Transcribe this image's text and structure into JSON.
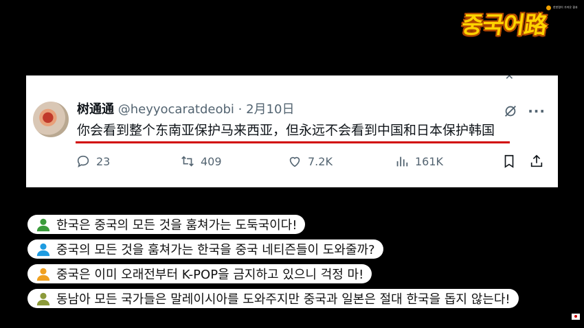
{
  "overlay": {
    "top_badge": "한한령이 가져온 결과",
    "logo": "중국어路"
  },
  "tweet": {
    "display_name": "树通通",
    "handle": "@heyyocaratdeobi",
    "separator": "·",
    "date": "2月10日",
    "text": "你会看到整个东南亚保护马来西亚，但永远不会看到中国和日本保护韩国",
    "stats": {
      "replies": "23",
      "retweets": "409",
      "likes": "7.2K",
      "views": "161K"
    }
  },
  "subtitles": [
    {
      "text": "한국은 중국의 모든 것을 훔쳐가는 도둑국이다!",
      "color": "#3a9b3a"
    },
    {
      "text": "중국의 모든 것을 훔쳐가는 한국을 중국 네티즌들이 도와줄까?",
      "color": "#1e9be0"
    },
    {
      "text": "중국은 이미 오래전부터 K-POP을 금지하고 있으니 걱정 마!",
      "color": "#f0a020"
    },
    {
      "text": "동남아 모든 국가들은 말레이시아를 도와주지만 중국과 일본은 절대 한국을 돕지 않는다!",
      "color": "#8c9a3a"
    }
  ]
}
